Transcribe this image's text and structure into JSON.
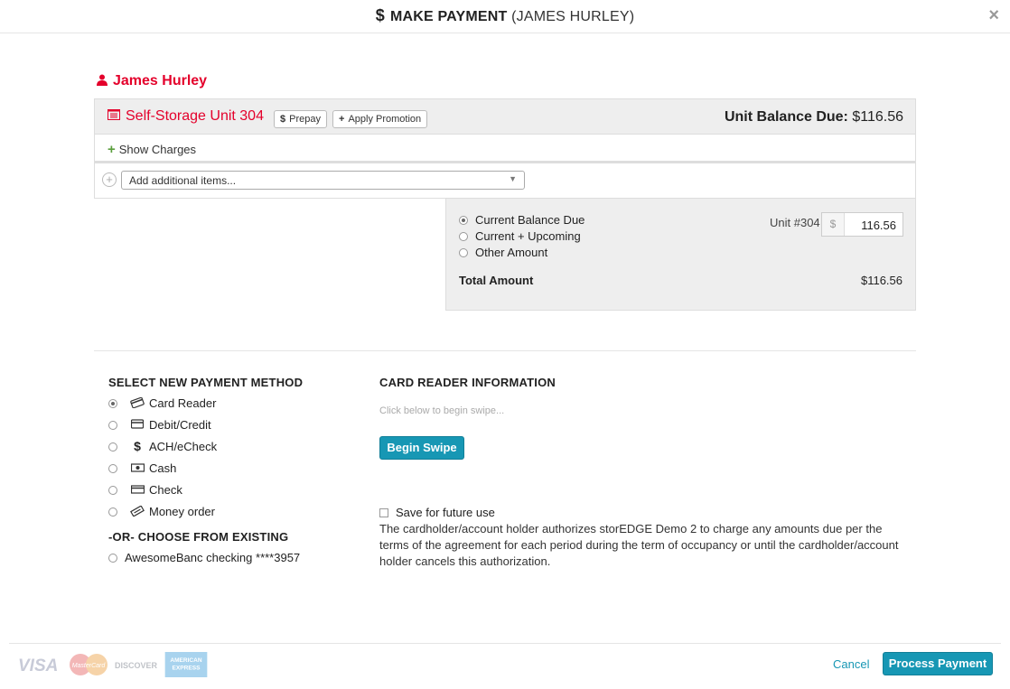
{
  "modal": {
    "title_strong": "MAKE PAYMENT",
    "title_light": "(JAMES HURLEY)",
    "dollar_icon": "dollar-icon",
    "close": "×"
  },
  "tenant": {
    "name": "James Hurley",
    "icon": "person-icon"
  },
  "unit": {
    "title": "Self-Storage Unit 304",
    "icon": "storage-unit-icon",
    "prepay_label": "Prepay",
    "promotion_label": "Apply Promotion",
    "balance_label": "Unit Balance Due:",
    "balance_value": "$116.56",
    "show_charges_label": "Show Charges",
    "add_items_placeholder": "Add additional items..."
  },
  "amount": {
    "options": [
      {
        "label": "Current Balance Due",
        "checked": true
      },
      {
        "label": "Current + Upcoming",
        "checked": false
      },
      {
        "label": "Other Amount",
        "checked": false
      }
    ],
    "unit_label": "Unit #304",
    "currency": "$",
    "unit_amount": "116.56",
    "total_label": "Total Amount",
    "total_value": "$116.56"
  },
  "payment_methods": {
    "heading": "SELECT NEW PAYMENT METHOD",
    "items": [
      {
        "label": "Card Reader",
        "icon": "card-swipe-icon",
        "checked": true
      },
      {
        "label": "Debit/Credit",
        "icon": "credit-card-icon",
        "checked": false
      },
      {
        "label": "ACH/eCheck",
        "icon": "dollar-icon",
        "checked": false
      },
      {
        "label": "Cash",
        "icon": "cash-icon",
        "checked": false
      },
      {
        "label": "Check",
        "icon": "check-icon",
        "checked": false
      },
      {
        "label": "Money order",
        "icon": "money-order-icon",
        "checked": false
      }
    ],
    "existing_heading": "-OR- CHOOSE FROM EXISTING",
    "existing_items": [
      {
        "label": "AwesomeBanc checking ****3957"
      }
    ]
  },
  "card_reader": {
    "heading": "CARD READER INFORMATION",
    "hint": "Click below to begin swipe...",
    "begin_swipe_label": "Begin Swipe",
    "save_label": "Save for future use",
    "authorization_text": "The cardholder/account holder authorizes storEDGE Demo 2 to charge any amounts due per the terms of the agreement for each period during the term of occupancy or until the cardholder/account holder cancels this authorization."
  },
  "footer": {
    "cards": [
      "VISA",
      "MasterCard",
      "DISCOVER",
      "AMERICAN EXPRESS"
    ],
    "cancel_label": "Cancel",
    "process_label": "Process Payment"
  },
  "colors": {
    "accent": "#e4002b",
    "primary": "#1797b4",
    "panel": "#eeeeee"
  }
}
